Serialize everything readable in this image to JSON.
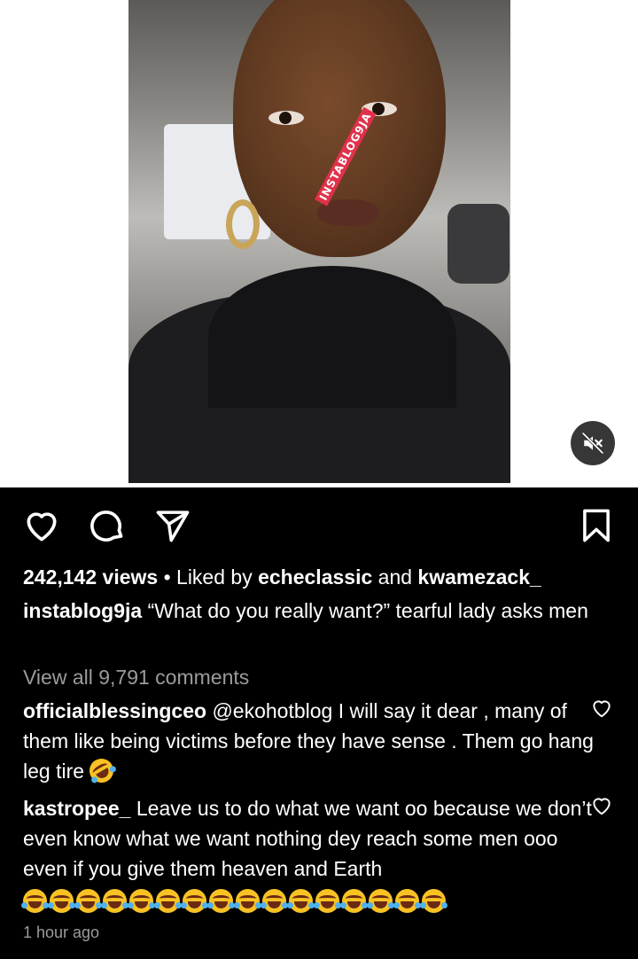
{
  "video": {
    "watermark": "INSTABLOG9JA",
    "mute_icon": "speaker-muted-icon"
  },
  "actions": {
    "like_icon": "heart-icon",
    "comment_icon": "comment-bubble-icon",
    "share_icon": "paper-plane-icon",
    "save_icon": "bookmark-icon"
  },
  "post": {
    "views": "242,142 views",
    "separator": " • ",
    "liked_by_prefix": "Liked by ",
    "liked_user_1": "echeclassic",
    "liked_and": " and ",
    "liked_user_2": "kwamezack_",
    "author": "instablog9ja",
    "caption": " “What do you really want?” tearful  lady asks men",
    "view_all_comments": "View all 9,791 comments",
    "time_ago": "1 hour ago"
  },
  "comments": [
    {
      "username": "officialblessingceo",
      "text": " @ekohotblog I will say it dear , many of them like being victims before they have sense . Them go hang leg tire ",
      "emoji_count": 1,
      "emoji_name": "rolling-on-floor-laughing-emoji"
    },
    {
      "username": "kastropee_",
      "text": " Leave us to do what we want oo because we don’t even know what we want nothing dey reach some men ooo even if you give them heaven and Earth",
      "emoji_count": 16,
      "emoji_name": "face-with-tears-of-joy-emoji"
    }
  ],
  "colors": {
    "background": "#000000",
    "text": "#ffffff",
    "muted_text": "#9b9b9b",
    "watermark_bg": "#e0314b"
  }
}
